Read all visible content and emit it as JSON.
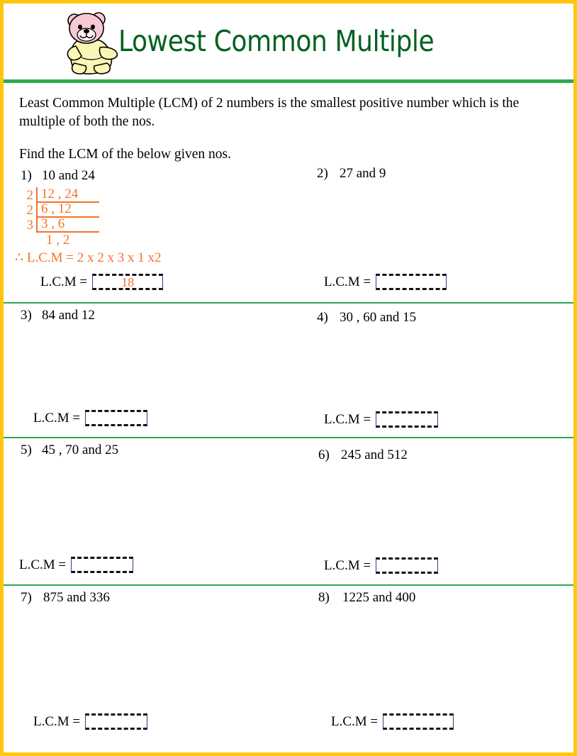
{
  "header": {
    "title": "Lowest Common Multiple",
    "mascot": "teddy-bear-icon",
    "title_color": "#03611f",
    "border_color": "#ffc60b",
    "divider_color": "#2eaa4f"
  },
  "intro": {
    "definition": "Least Common Multiple (LCM) of 2 numbers is the smallest positive number which is the multiple of both the nos.",
    "instruction": "Find the LCM of the below given nos."
  },
  "answer_label": "L.C.M =",
  "worked_example": {
    "color": "#f4722b",
    "ladder": [
      {
        "divisor": "2",
        "pair": "12 , 24"
      },
      {
        "divisor": "2",
        "pair": "6  , 12"
      },
      {
        "divisor": "3",
        "pair": "3  ,  6"
      },
      {
        "divisor": "",
        "pair": "1 ,  2"
      }
    ],
    "result_line": "∴ L.C.M = 2 x 2 x 3 x 1 x2",
    "answer": "18"
  },
  "problems": [
    {
      "num": "1)",
      "text": "10 and 24",
      "answer": "18",
      "solved": true
    },
    {
      "num": "2)",
      "text": "27 and 9",
      "answer": "",
      "solved": false
    },
    {
      "num": "3)",
      "text": "84  and 12",
      "answer": "",
      "solved": false
    },
    {
      "num": "4)",
      "text": "30 , 60 and 15",
      "answer": "",
      "solved": false
    },
    {
      "num": "5)",
      "text": "45 , 70 and  25",
      "answer": "",
      "solved": false
    },
    {
      "num": "6)",
      "text": "245 and 512",
      "answer": "",
      "solved": false
    },
    {
      "num": "7)",
      "text": "875 and 336",
      "answer": "",
      "solved": false
    },
    {
      "num": "8)",
      "text": "1225 and 400",
      "answer": "",
      "solved": false
    }
  ]
}
